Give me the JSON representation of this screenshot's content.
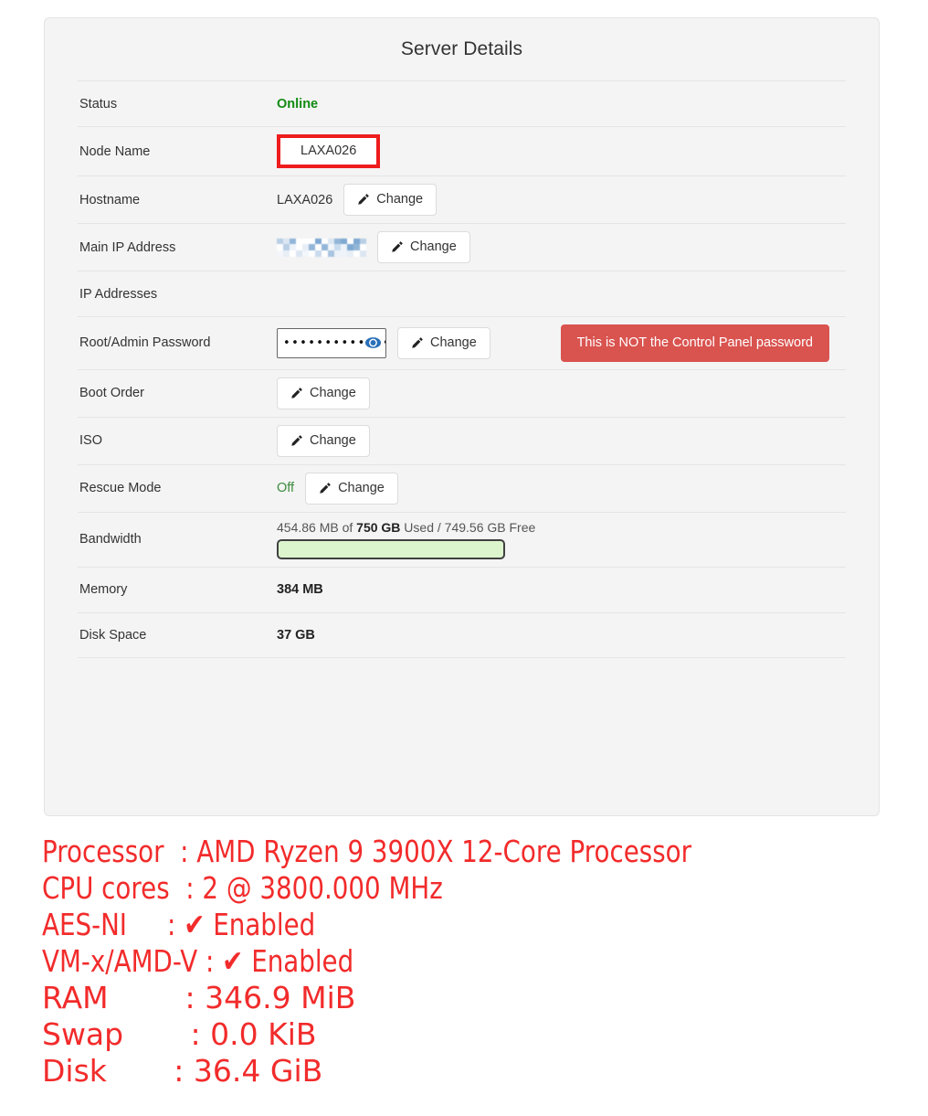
{
  "panel": {
    "title": "Server Details",
    "rows": [
      {
        "key": "status",
        "label": "Status",
        "value": "Online"
      },
      {
        "key": "node_name",
        "label": "Node Name",
        "value": "LAXA026"
      },
      {
        "key": "hostname",
        "label": "Hostname",
        "value": "LAXA026",
        "button": "Change"
      },
      {
        "key": "main_ip",
        "label": "Main IP Address",
        "value": "",
        "button": "Change"
      },
      {
        "key": "ip_addresses",
        "label": "IP Addresses",
        "value": ""
      },
      {
        "key": "root_password",
        "label": "Root/Admin Password",
        "value": "•••••••••••••••••",
        "button": "Change",
        "warning": "This is NOT the Control Panel password"
      },
      {
        "key": "boot_order",
        "label": "Boot Order",
        "value": "",
        "button": "Change"
      },
      {
        "key": "iso",
        "label": "ISO",
        "value": "",
        "button": "Change"
      },
      {
        "key": "rescue_mode",
        "label": "Rescue Mode",
        "value": "Off",
        "button": "Change"
      },
      {
        "key": "bandwidth",
        "label": "Bandwidth",
        "value": ""
      },
      {
        "key": "memory",
        "label": "Memory",
        "value": "384 MB"
      },
      {
        "key": "disk_space",
        "label": "Disk Space",
        "value": "37 GB"
      }
    ],
    "bandwidth": {
      "used": "454.86 MB",
      "total": "750 GB",
      "free": "749.56 GB",
      "text_prefix": "454.86 MB of ",
      "text_total": "750 GB",
      "text_suffix": " Used / 749.56 GB Free",
      "percent_used": 6,
      "fill_color": "#5cc45c",
      "track_color": "#ddf5cd"
    },
    "colors": {
      "panel_bg": "#f4f4f4",
      "status_green": "#128a12",
      "warning_red": "#d9534f",
      "annotation_red": "#ee1c1c",
      "console_red": "#f22b2b"
    }
  },
  "console": {
    "lines": [
      {
        "id": "processor",
        "text": "Processor  : AMD Ryzen 9 3900X 12-Core Processor",
        "style": "cond"
      },
      {
        "id": "cpu_cores",
        "text": "CPU cores  : 2 @ 3800.000 MHz",
        "style": "cond"
      },
      {
        "id": "aes_ni",
        "text": "AES-NI     : ✔ Enabled",
        "style": "cond"
      },
      {
        "id": "vmx_amdv",
        "text": "VM-x/AMD-V : ✔ Enabled",
        "style": "cond"
      },
      {
        "id": "ram",
        "text": "RAM        : 346.9 MiB",
        "style": "wide"
      },
      {
        "id": "swap",
        "text": "Swap       : 0.0 KiB",
        "style": "wide"
      },
      {
        "id": "disk",
        "text": "Disk       : 36.4 GiB",
        "style": "wide"
      }
    ]
  }
}
